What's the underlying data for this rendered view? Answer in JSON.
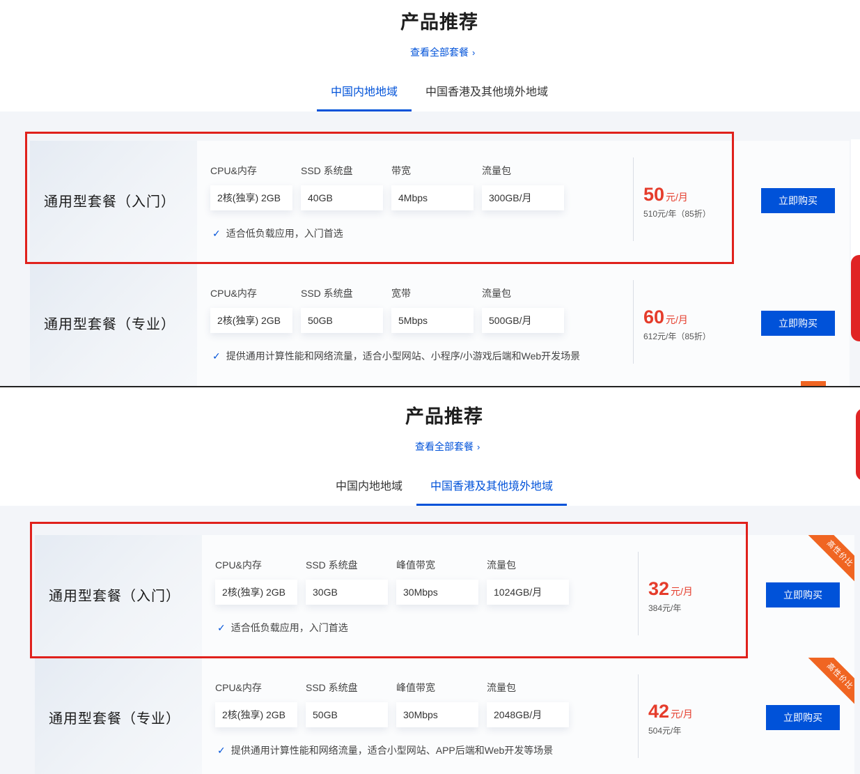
{
  "screenshots": [
    {
      "title": "产品推荐",
      "view_all": "查看全部套餐",
      "tabs": [
        {
          "label": "中国内地地域",
          "active": true
        },
        {
          "label": "中国香港及其他境外地域",
          "active": false
        }
      ],
      "cards": [
        {
          "name": "通用型套餐（入门）",
          "specs": [
            {
              "label": "CPU&内存",
              "value": "2核(独享) 2GB"
            },
            {
              "label": "SSD 系统盘",
              "value": "40GB"
            },
            {
              "label": "带宽",
              "value": "4Mbps"
            },
            {
              "label": "流量包",
              "value": "300GB/月"
            }
          ],
          "feature": "适合低负载应用，入门首选",
          "price": "50",
          "price_unit": "元/月",
          "yearly": "510元/年（85折）",
          "buy_label": "立即购买",
          "badge": ""
        },
        {
          "name": "通用型套餐（专业）",
          "specs": [
            {
              "label": "CPU&内存",
              "value": "2核(独享) 2GB"
            },
            {
              "label": "SSD 系统盘",
              "value": "50GB"
            },
            {
              "label": "宽带",
              "value": "5Mbps"
            },
            {
              "label": "流量包",
              "value": "500GB/月"
            }
          ],
          "feature": "提供通用计算性能和网络流量，适合小型网站、小程序/小游戏后端和Web开发场景",
          "price": "60",
          "price_unit": "元/月",
          "yearly": "612元/年（85折）",
          "buy_label": "立即购买",
          "badge": ""
        }
      ]
    },
    {
      "title": "产品推荐",
      "view_all": "查看全部套餐",
      "tabs": [
        {
          "label": "中国内地地域",
          "active": false
        },
        {
          "label": "中国香港及其他境外地域",
          "active": true
        }
      ],
      "cards": [
        {
          "name": "通用型套餐（入门）",
          "specs": [
            {
              "label": "CPU&内存",
              "value": "2核(独享) 2GB"
            },
            {
              "label": "SSD 系统盘",
              "value": "30GB"
            },
            {
              "label": "峰值带宽",
              "value": "30Mbps"
            },
            {
              "label": "流量包",
              "value": "1024GB/月"
            }
          ],
          "feature": "适合低负载应用，入门首选",
          "price": "32",
          "price_unit": "元/月",
          "yearly": "384元/年",
          "buy_label": "立即购买",
          "badge": "高性价比"
        },
        {
          "name": "通用型套餐（专业）",
          "specs": [
            {
              "label": "CPU&内存",
              "value": "2核(独享) 2GB"
            },
            {
              "label": "SSD 系统盘",
              "value": "50GB"
            },
            {
              "label": "峰值带宽",
              "value": "30Mbps"
            },
            {
              "label": "流量包",
              "value": "2048GB/月"
            }
          ],
          "feature": "提供通用计算性能和网络流量，适合小型网站、APP后端和Web开发等场景",
          "price": "42",
          "price_unit": "元/月",
          "yearly": "504元/年",
          "buy_label": "立即购买",
          "badge": "高性价比"
        }
      ]
    }
  ],
  "colors": {
    "accent": "#0052d9",
    "price": "#e53c2b",
    "highlight_box": "#e0211c",
    "badge": "#f06522"
  },
  "icons": {
    "feature_check": "check-icon",
    "view_all_chevron": "chevron-right-icon"
  }
}
